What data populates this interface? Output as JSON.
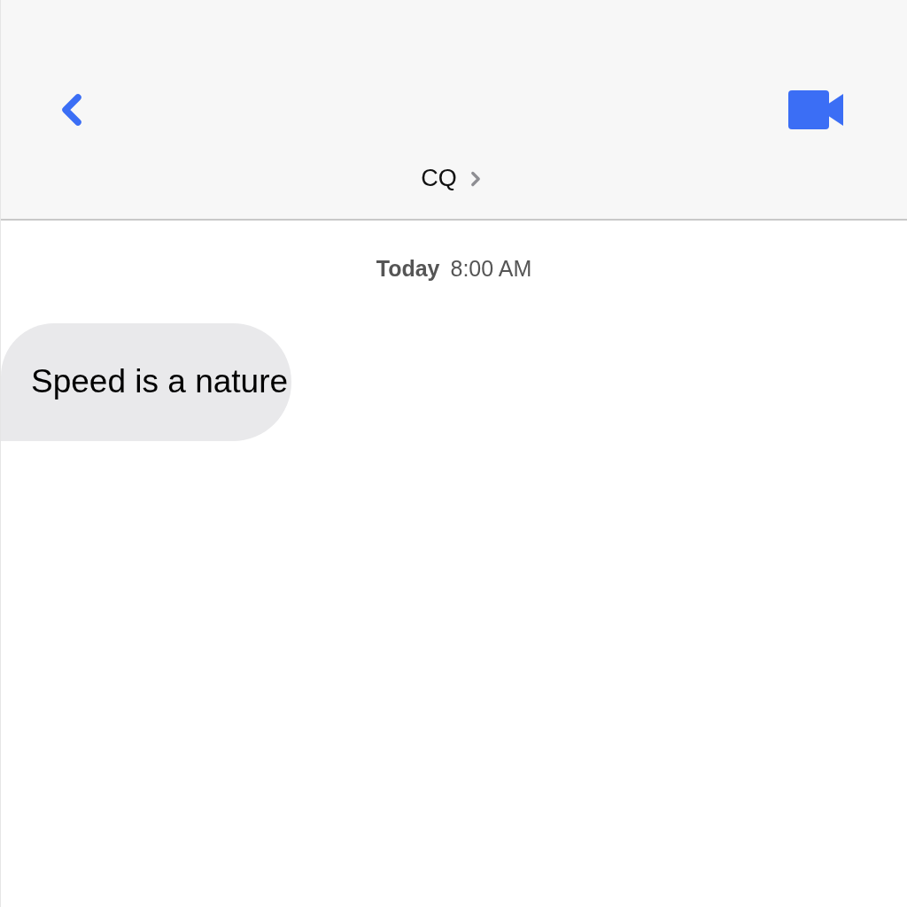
{
  "header": {
    "contact_name": "CQ"
  },
  "timestamp": {
    "day": "Today",
    "time": "8:00 AM"
  },
  "messages": [
    {
      "text": "Speed is a nature",
      "incoming": true
    }
  ]
}
